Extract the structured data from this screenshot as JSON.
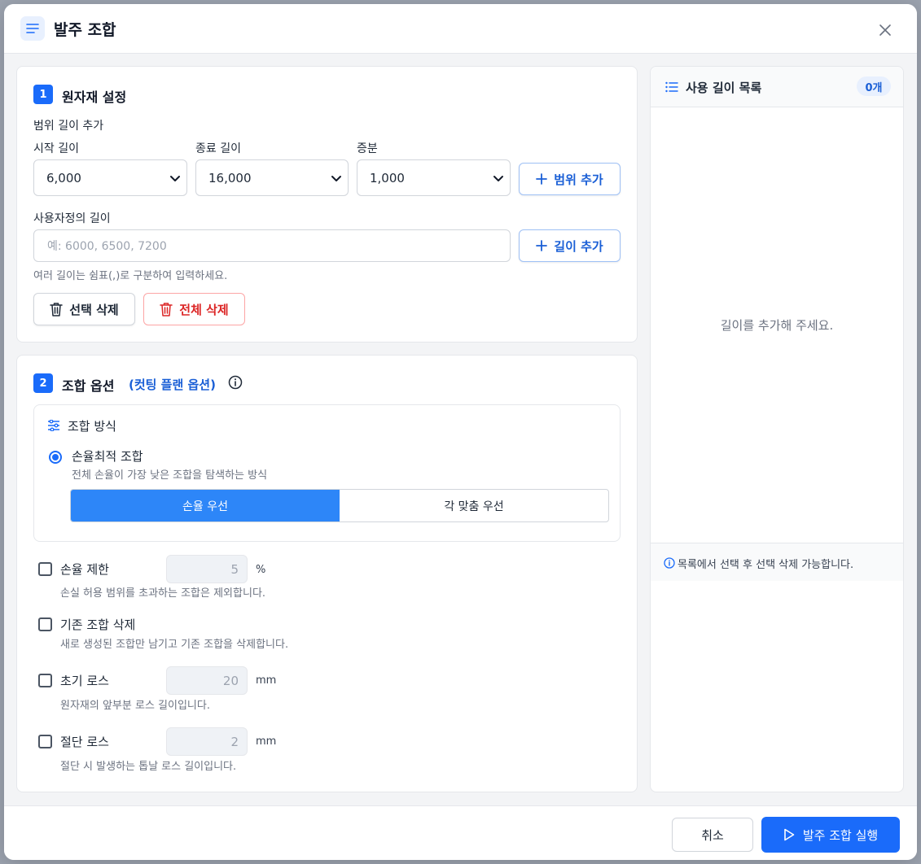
{
  "dialog": {
    "title": "발주 조합",
    "icon": "menu-lines-icon"
  },
  "material": {
    "step": "1",
    "title": "원자재 설정",
    "range_title": "범위 길이 추가",
    "start_label": "시작 길이",
    "start_value": "6,000",
    "end_label": "종료 길이",
    "end_value": "16,000",
    "step_label": "증분",
    "step_value": "1,000",
    "add_range_label": "범위 추가",
    "custom_label": "사용자정의 길이",
    "custom_placeholder": "예: 6000, 6500, 7200",
    "add_length_label": "길이 추가",
    "custom_hint": "여러 길이는 쉼표(,)로 구분하여 입력하세요.",
    "delete_selected_label": "선택 삭제",
    "delete_all_label": "전체 삭제"
  },
  "options": {
    "step": "2",
    "title": "조합 옵션",
    "subtitle": "(컷팅 플랜 옵션)",
    "method_title": "조합 방식",
    "method_option_label": "손율최적 조합",
    "method_option_desc": "전체 손율이 가장 낮은 조합을 탐색하는 방식",
    "segments": [
      "손율 우선",
      "각 맞춤 우선"
    ],
    "active_segment": "손율 우선",
    "loss_limit_label": "손율 제한",
    "loss_limit_value": "5",
    "loss_limit_unit": "%",
    "loss_limit_desc": "손실 허용 범위를 초과하는 조합은 제외합니다.",
    "delete_existing_label": "기존 조합 삭제",
    "delete_existing_desc": "새로 생성된 조합만 남기고 기존 조합을 삭제합니다.",
    "initial_loss_label": "초기 로스",
    "initial_loss_value": "20",
    "initial_loss_unit": "mm",
    "initial_loss_desc": "원자재의 앞부분 로스 길이입니다.",
    "cut_loss_label": "절단 로스",
    "cut_loss_value": "2",
    "cut_loss_unit": "mm",
    "cut_loss_desc": "절단 시 발생하는 톱날 로스 길이입니다."
  },
  "length_list": {
    "title": "사용 길이 목록",
    "count": "0개",
    "empty_text": "길이를 추가해 주세요.",
    "footer_hint": "목록에서 선택 후 선택 삭제 가능합니다."
  },
  "footer": {
    "cancel_label": "취소",
    "run_label": "발주 조합 실행"
  },
  "colors": {
    "primary": "#1a6bfa",
    "danger": "#dc2626"
  }
}
